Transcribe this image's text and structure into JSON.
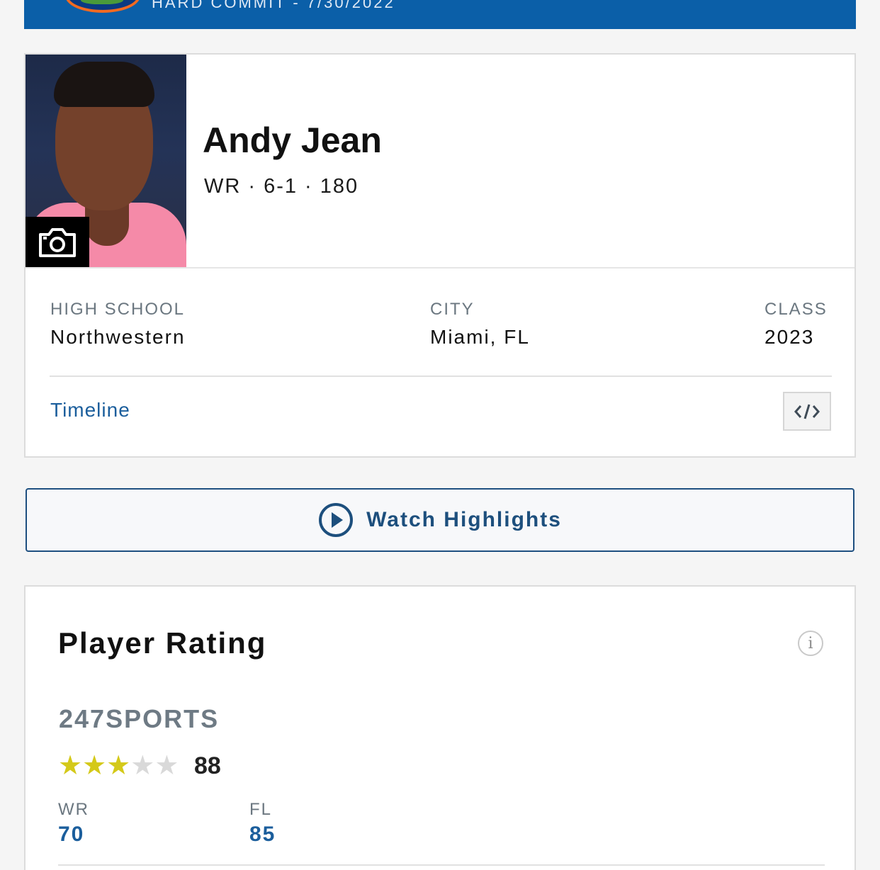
{
  "banner": {
    "commit_text": "HARD COMMIT - 7/30/2022",
    "logo_icon": "gators-logo-icon"
  },
  "player": {
    "name": "Andy Jean",
    "meta": "WR · 6-1 · 180",
    "photo_icon": "camera-icon"
  },
  "details": {
    "high_school_label": "HIGH SCHOOL",
    "high_school_value": "Northwestern",
    "city_label": "CITY",
    "city_value": "Miami, FL",
    "class_label": "CLASS",
    "class_value": "2023"
  },
  "links": {
    "timeline": "Timeline",
    "embed_icon": "code-embed-icon"
  },
  "highlights": {
    "label": "Watch Highlights",
    "icon": "play-circle-icon"
  },
  "rating": {
    "title": "Player Rating",
    "source": "247SPORTS",
    "stars_filled": 3,
    "stars_total": 5,
    "score": "88",
    "ranks": [
      {
        "label": "WR",
        "value": "70"
      },
      {
        "label": "FL",
        "value": "85"
      }
    ]
  },
  "colors": {
    "banner_blue": "#0b5fa8",
    "link_blue": "#1b5e9c",
    "star_gold": "#d4c919",
    "star_empty": "#d9d9d9"
  }
}
